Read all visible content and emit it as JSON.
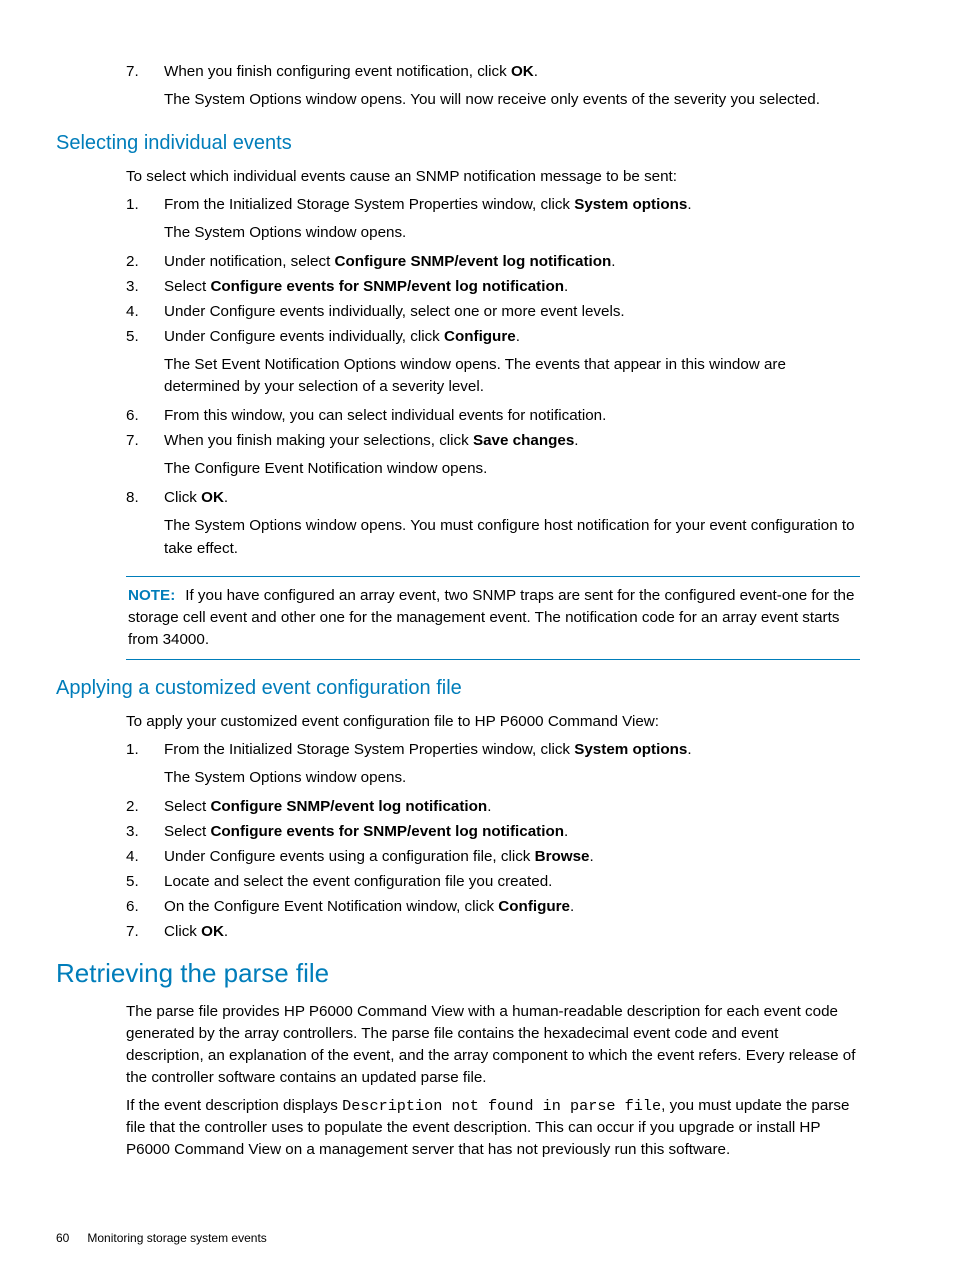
{
  "top_continuation": {
    "num": "7.",
    "line1_a": "When you finish configuring event notification, click ",
    "line1_bold": "OK",
    "line1_b": ".",
    "sub": "The System Options window opens. You will now receive only events of the severity you selected."
  },
  "sec1": {
    "title": "Selecting individual events",
    "intro": "To select which individual events cause an SNMP notification message to be sent:",
    "items": [
      {
        "n": "1.",
        "a": "From the Initialized Storage System Properties window, click ",
        "b1": "System options",
        "c": ".",
        "sub": "The System Options window opens."
      },
      {
        "n": "2.",
        "a": "Under notification, select ",
        "b1": "Configure SNMP/event log notification",
        "c": "."
      },
      {
        "n": "3.",
        "a": "Select ",
        "b1": "Configure events for SNMP/event log notification",
        "c": "."
      },
      {
        "n": "4.",
        "a": "Under Configure events individually, select one or more event levels."
      },
      {
        "n": "5.",
        "a": "Under Configure events individually, click ",
        "b1": "Configure",
        "c": ".",
        "sub": "The Set Event Notification Options window opens. The events that appear in this window are determined by your selection of a severity level."
      },
      {
        "n": "6.",
        "a": "From this window, you can select individual events for notification."
      },
      {
        "n": "7.",
        "a": "When you finish making your selections, click ",
        "b1": "Save changes",
        "c": ".",
        "sub": "The Configure Event Notification window opens."
      },
      {
        "n": "8.",
        "a": "Click ",
        "b1": "OK",
        "c": ".",
        "sub": "The System Options window opens. You must configure host notification for your event configuration to take effect."
      }
    ],
    "note_label": "NOTE:",
    "note_text": "If you have configured an array event, two SNMP traps are sent for the configured event-one for the storage cell event and other one for the management event. The notification code for an array event starts from 34000."
  },
  "sec2": {
    "title": "Applying a customized event configuration file",
    "intro": "To apply your customized event configuration file to HP P6000 Command View:",
    "items": [
      {
        "n": "1.",
        "a": "From the Initialized Storage System Properties window, click ",
        "b1": "System options",
        "c": ".",
        "sub": "The System Options window opens."
      },
      {
        "n": "2.",
        "a": "Select ",
        "b1": "Configure SNMP/event log notification",
        "c": "."
      },
      {
        "n": "3.",
        "a": "Select ",
        "b1": "Configure events for SNMP/event log notification",
        "c": "."
      },
      {
        "n": "4.",
        "a": "Under Configure events using a configuration file, click ",
        "b1": "Browse",
        "c": "."
      },
      {
        "n": "5.",
        "a": "Locate and select the event configuration file you created."
      },
      {
        "n": "6.",
        "a": "On the Configure Event Notification window, click ",
        "b1": "Configure",
        "c": "."
      },
      {
        "n": "7.",
        "a": "Click ",
        "b1": "OK",
        "c": "."
      }
    ]
  },
  "sec3": {
    "title": "Retrieving the parse file",
    "para1": "The parse file provides HP P6000 Command View with a human-readable description for each event code generated by the array controllers. The parse file contains the hexadecimal event code and event description, an explanation of the event, and the array component to which the event refers. Every release of the controller software contains an updated parse file.",
    "para2a": "If the event description displays ",
    "para2mono": "Description not found in parse file",
    "para2b": ", you must update the parse file that the controller uses to populate the event description. This can occur if you upgrade or install HP P6000 Command View on a management server that has not previously run this software."
  },
  "footer": {
    "page": "60",
    "text": "Monitoring storage system events"
  }
}
